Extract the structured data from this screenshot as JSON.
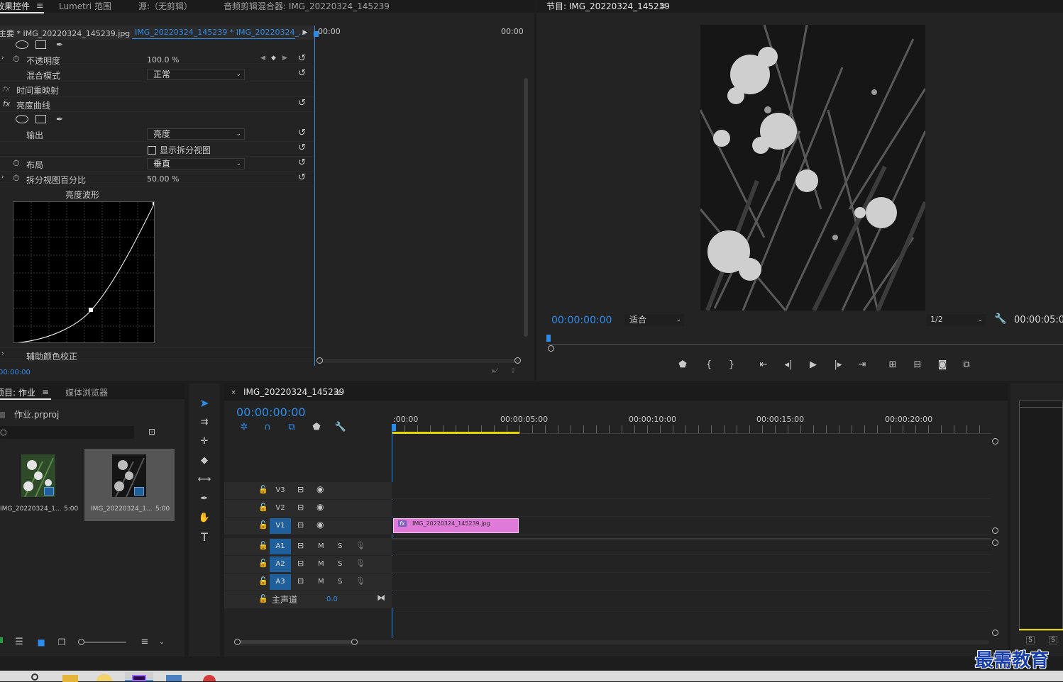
{
  "effect_controls": {
    "tabs": [
      "效果控件",
      "Lumetri 范围",
      "源:（无剪辑）",
      "音频剪辑混合器: IMG_20220324_145239"
    ],
    "master_clip": "主要 * IMG_20220324_145239.jpg",
    "sequence_clip": "IMG_20220324_145239 * IMG_20220324_...",
    "timeline_start": "00:00",
    "timeline_end": "00:00",
    "opacity_label": "不透明度",
    "opacity_value": "100.0 %",
    "blend_mode_label": "混合模式",
    "blend_mode_value": "正常",
    "time_remap_label": "时间重映射",
    "fx_label": "fx",
    "curves_label": "亮度曲线",
    "output_label": "输出",
    "output_value": "亮度",
    "split_view_label": "显示拆分视图",
    "layout_label": "布局",
    "layout_value": "垂直",
    "split_percent_label": "拆分视图百分比",
    "split_percent_value": "50.00 %",
    "waveform_label": "亮度波形",
    "secondary_label": "辅助颜色校正",
    "timecode": "00:00:00"
  },
  "program_monitor": {
    "title": "节目: IMG_20220324_145239",
    "timecode": "00:00:00:00",
    "fit_value": "适合",
    "resolution_value": "1/2",
    "duration": "00:00:05:0"
  },
  "project": {
    "tabs": [
      "项目: 作业",
      "媒体浏览器"
    ],
    "file_name": "作业.prproj",
    "items": [
      {
        "name": "IMG_20220324_1...",
        "duration": "5:00"
      },
      {
        "name": "IMG_20220324_1...",
        "duration": "5:00"
      }
    ]
  },
  "timeline": {
    "tab": "IMG_20220324_145239",
    "timecode": "00:00:00:00",
    "ruler": [
      ":00:00",
      "00:00:05:00",
      "00:00:10:00",
      "00:00:15:00",
      "00:00:20:00"
    ],
    "video_tracks": [
      "V3",
      "V2",
      "V1"
    ],
    "audio_tracks": [
      "A1",
      "A2",
      "A3"
    ],
    "track_buttons": {
      "mute": "M",
      "solo": "S"
    },
    "master_label": "主声道",
    "master_value": "0.0",
    "clip_name": "IMG_20220324_145239.jpg"
  },
  "audio_meter": {
    "solo_labels": [
      "S",
      "S"
    ]
  },
  "watermark": "最需教育",
  "colors": {
    "accent": "#2d8ceb",
    "clip": "#e07ad8",
    "panel_bg": "#232323"
  }
}
